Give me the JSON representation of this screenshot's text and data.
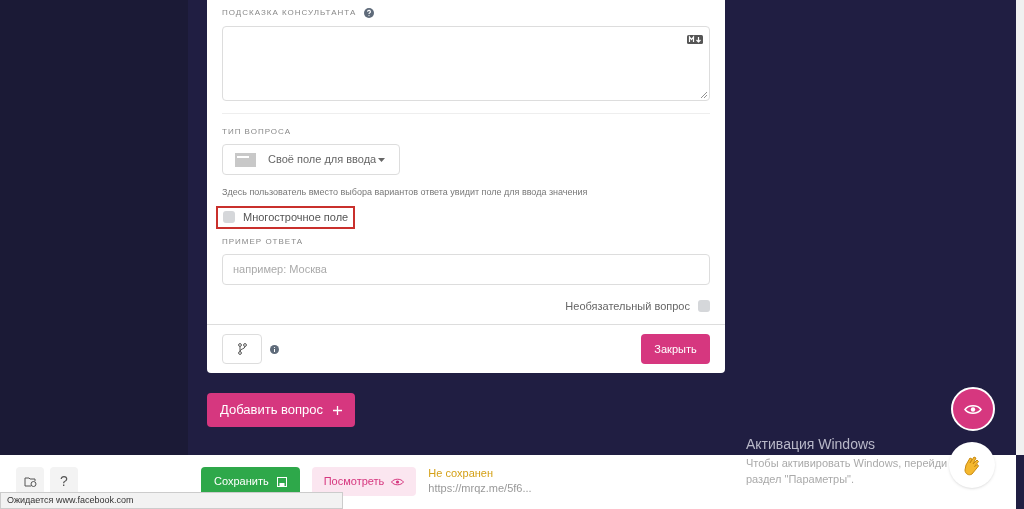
{
  "hint_field": {
    "label": "ПОДСКАЗКА КОНСУЛЬТАНТА"
  },
  "question_type": {
    "label": "ТИП ВОПРОСА",
    "value": "Своё поле для ввода",
    "description": "Здесь пользователь вместо выбора вариантов ответа увидит поле для ввода значения"
  },
  "multiline": {
    "label": "Многострочное поле",
    "checked": false,
    "highlighted": true
  },
  "answer_example": {
    "label": "ПРИМЕР ОТВЕТА",
    "placeholder": "например: Москва"
  },
  "optional": {
    "label": "Необязательный вопрос",
    "checked": false
  },
  "close_button": "Закрыть",
  "add_question_button": "Добавить вопрос",
  "bottom_bar": {
    "save_button": "Сохранить",
    "preview_button": "Посмотреть",
    "save_status": "Не сохранен",
    "link": "https://mrqz.me/5f6...",
    "help_button": "?"
  },
  "windows_activation": {
    "title": "Активация Windows",
    "lines": [
      "Чтобы активировать Windows, перейди",
      "раздел \"Параметры\"."
    ]
  },
  "browser_status": "Ожидается www.facebook.com"
}
